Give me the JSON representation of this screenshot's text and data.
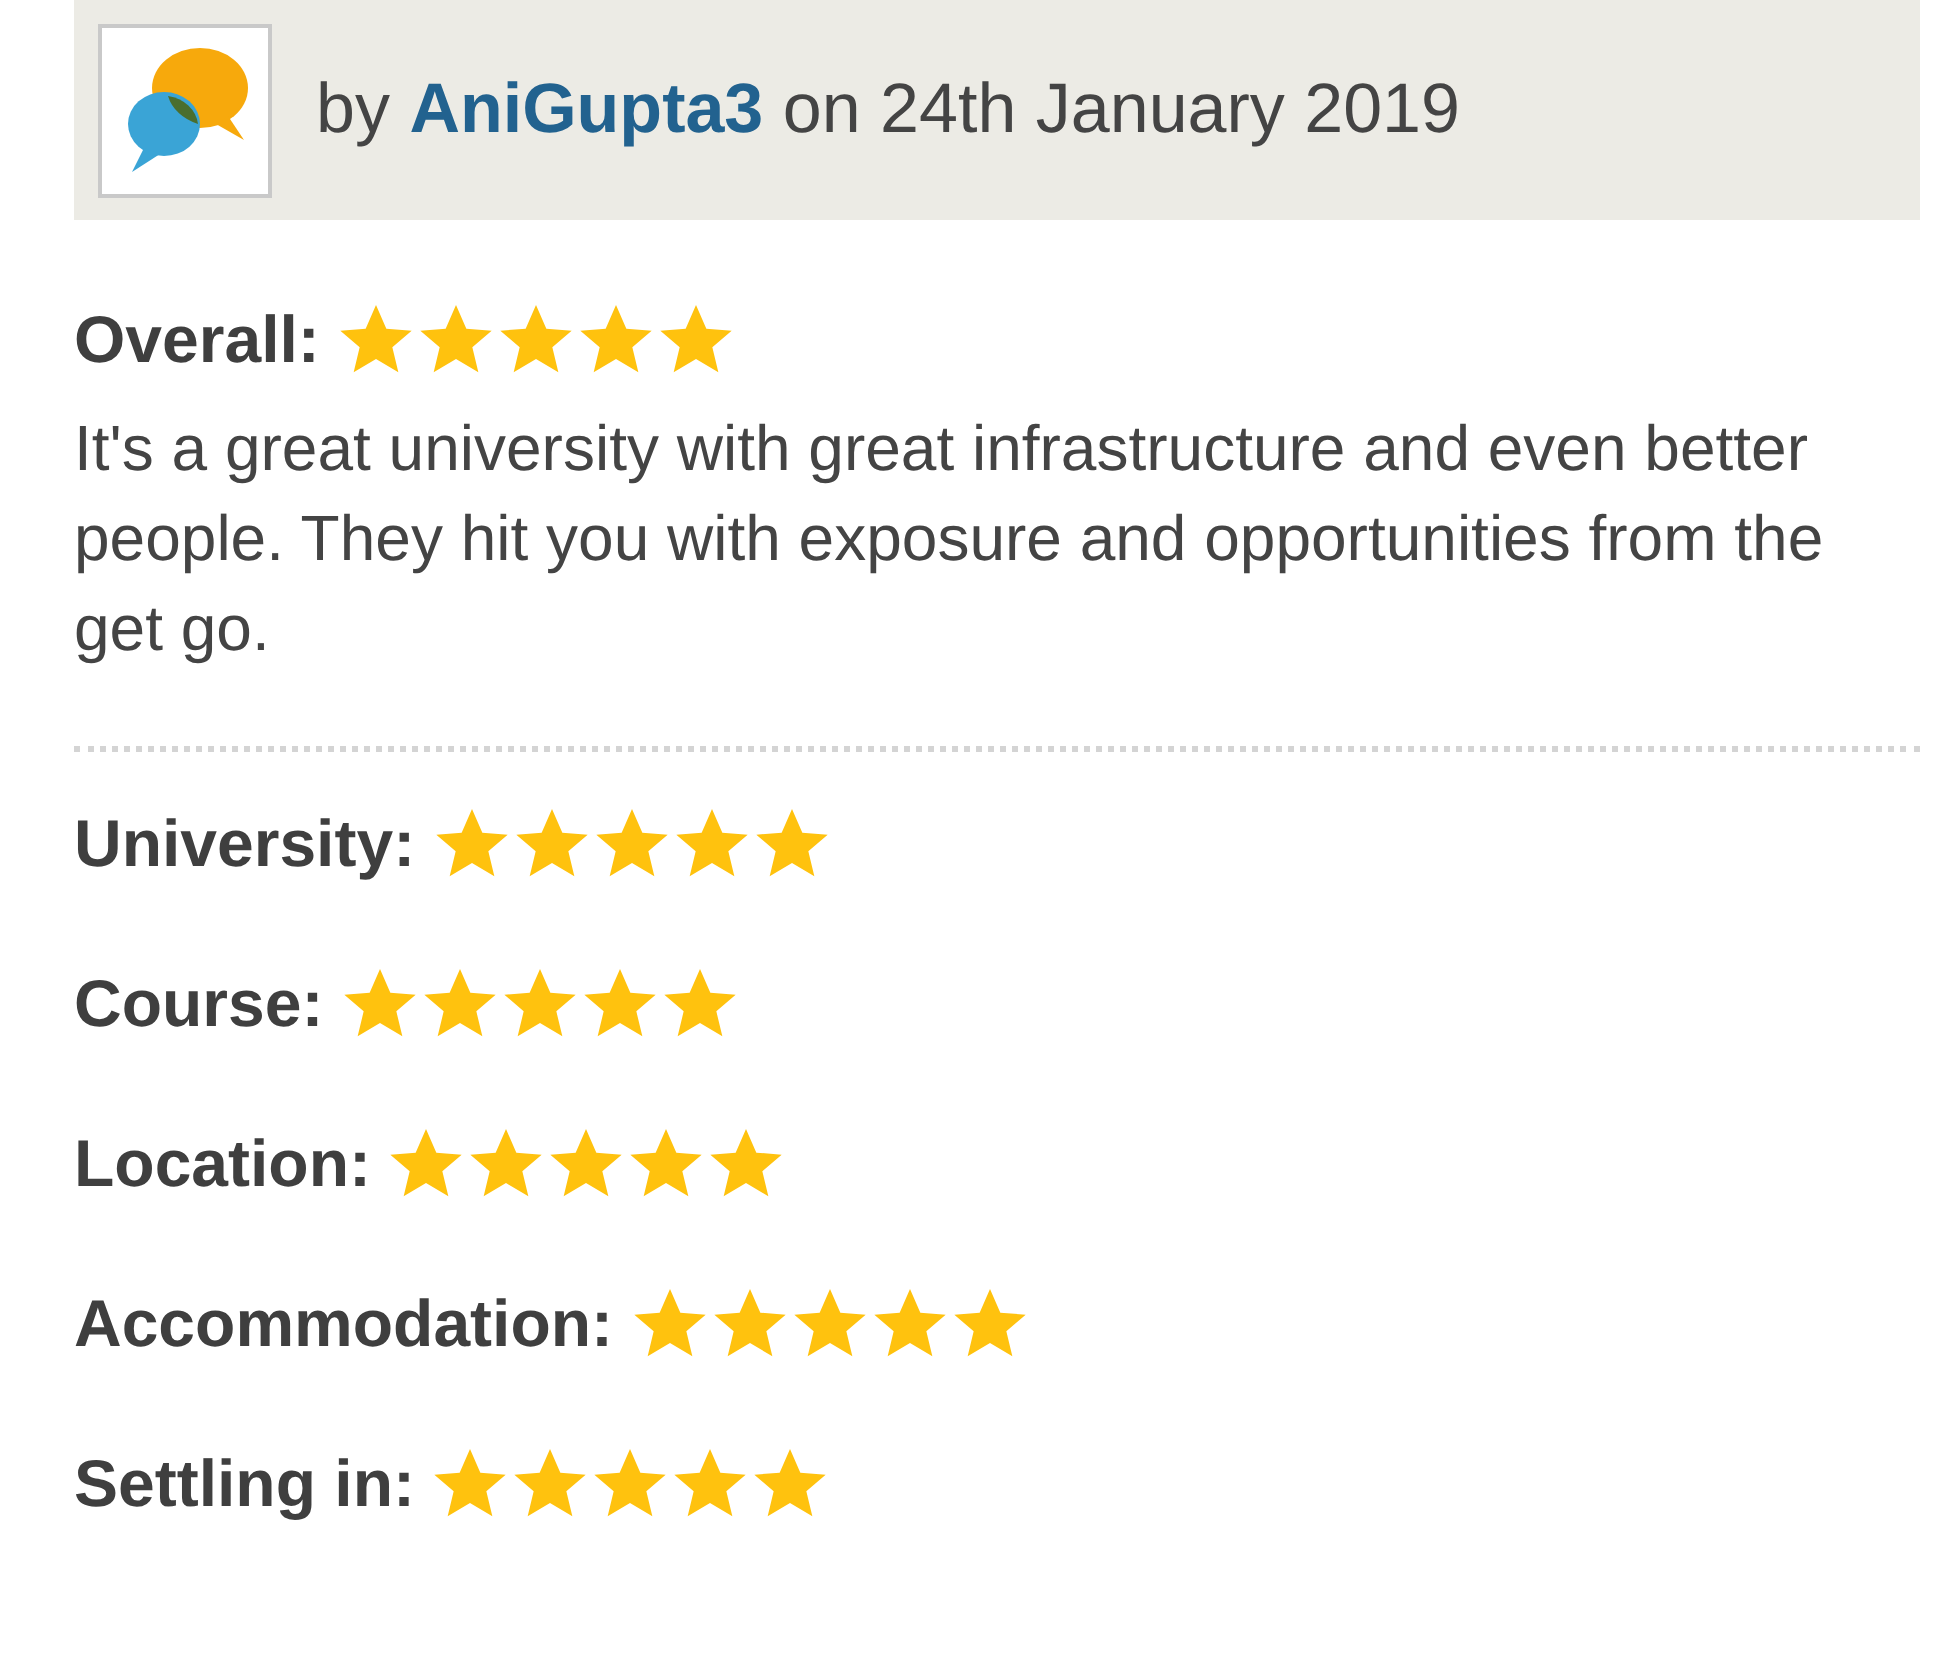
{
  "review": {
    "prefix": "by",
    "author": "AniGupta3",
    "date_text": "on 24th January 2019"
  },
  "overall": {
    "label": "Overall:",
    "stars": 5
  },
  "text": "It's a great university with great infrastructure and even better people. They hit you with exposure and opportunities from the get go.",
  "ratings": [
    {
      "label": "University:",
      "stars": 5
    },
    {
      "label": "Course:",
      "stars": 5
    },
    {
      "label": "Location:",
      "stars": 5
    },
    {
      "label": "Accommodation:",
      "stars": 5
    },
    {
      "label": "Settling in:",
      "stars": 5
    }
  ]
}
